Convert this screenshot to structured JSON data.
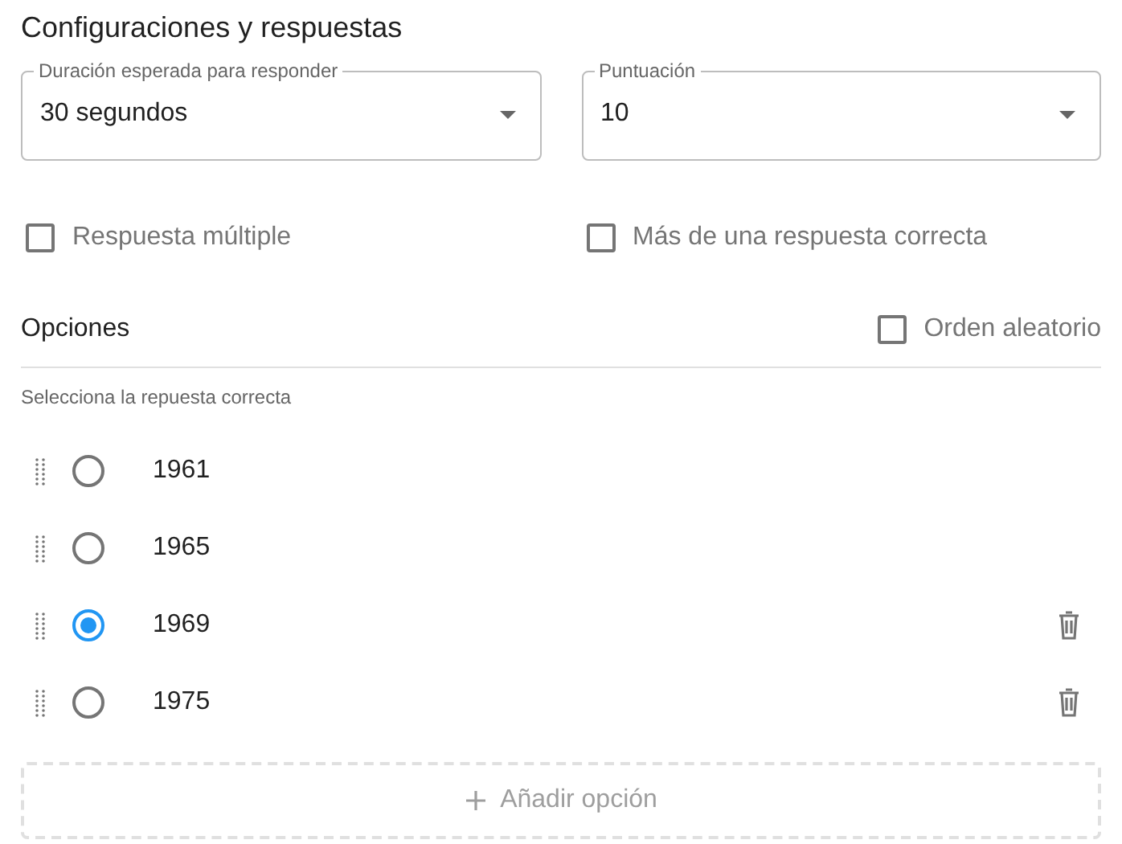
{
  "title": "Configuraciones y respuestas",
  "fields": [
    {
      "label": "Duración esperada para responder",
      "value": "30 segundos"
    },
    {
      "label": "Puntuación",
      "value": "10"
    }
  ],
  "checkboxes": [
    {
      "label": "Respuesta múltiple",
      "checked": false
    },
    {
      "label": "Más de una respuesta correcta",
      "checked": false
    }
  ],
  "options_section": {
    "title": "Opciones",
    "shuffle": {
      "label": "Orden aleatorio",
      "checked": false
    },
    "hint": "Selecciona la repuesta correcta",
    "options": [
      {
        "label": "1961",
        "selected": false,
        "deletable": false
      },
      {
        "label": "1965",
        "selected": false,
        "deletable": false
      },
      {
        "label": "1969",
        "selected": true,
        "deletable": true
      },
      {
        "label": "1975",
        "selected": false,
        "deletable": true
      }
    ],
    "add_button": "Añadir opción"
  }
}
